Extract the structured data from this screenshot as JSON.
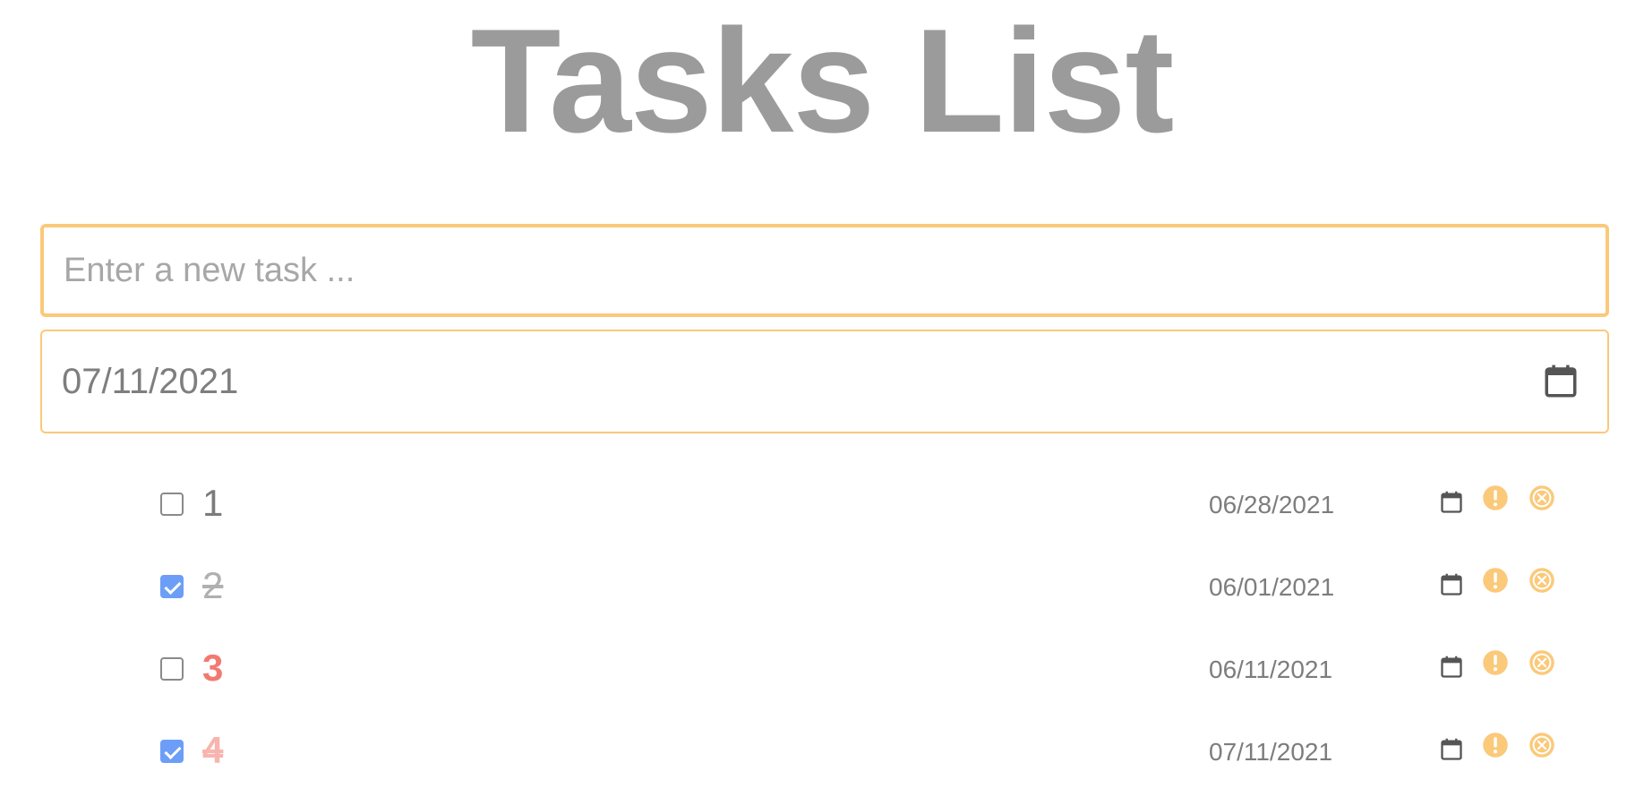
{
  "header": {
    "title": "Tasks List"
  },
  "new_task": {
    "placeholder": "Enter a new task ..."
  },
  "date_picker": {
    "value": "07/11/2021",
    "icon": "calendar-icon"
  },
  "colors": {
    "accent": "#fbc97a",
    "important": "#f27a72",
    "checkbox_checked": "#6c9ef8",
    "text_gray": "#9b9b9b"
  },
  "tasks": [
    {
      "label": "1",
      "due": "06/28/2021",
      "done": false,
      "important": false
    },
    {
      "label": "2",
      "due": "06/01/2021",
      "done": true,
      "important": false
    },
    {
      "label": "3",
      "due": "06/11/2021",
      "done": false,
      "important": true
    },
    {
      "label": "4",
      "due": "07/11/2021",
      "done": true,
      "important": true
    }
  ],
  "row_icons": [
    "calendar-icon",
    "exclamation-icon",
    "close-icon"
  ]
}
